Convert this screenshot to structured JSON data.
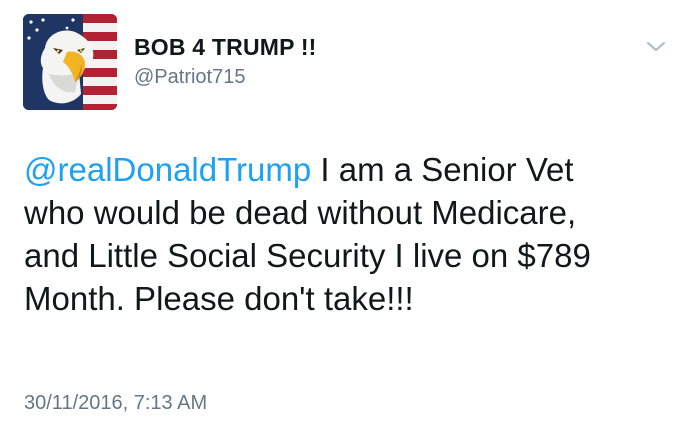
{
  "tweet": {
    "display_name": "BOB 4 TRUMP !!",
    "username": "@Patriot715",
    "mention": "@realDonaldTrump",
    "line1_rest": " I am a Senior Vet",
    "line2": "who would be dead without Medicare,",
    "line3": "and Little Social Security I live on $789",
    "line4": "Month. Please don't take!!!",
    "timestamp": "30/11/2016, 7:13 AM"
  },
  "icons": {
    "avatar": "bald-eagle-flag-avatar",
    "menu": "chevron-down-icon"
  },
  "colors": {
    "mention": "#1da1f2",
    "secondary_text": "#657786",
    "primary_text": "#14171a"
  }
}
